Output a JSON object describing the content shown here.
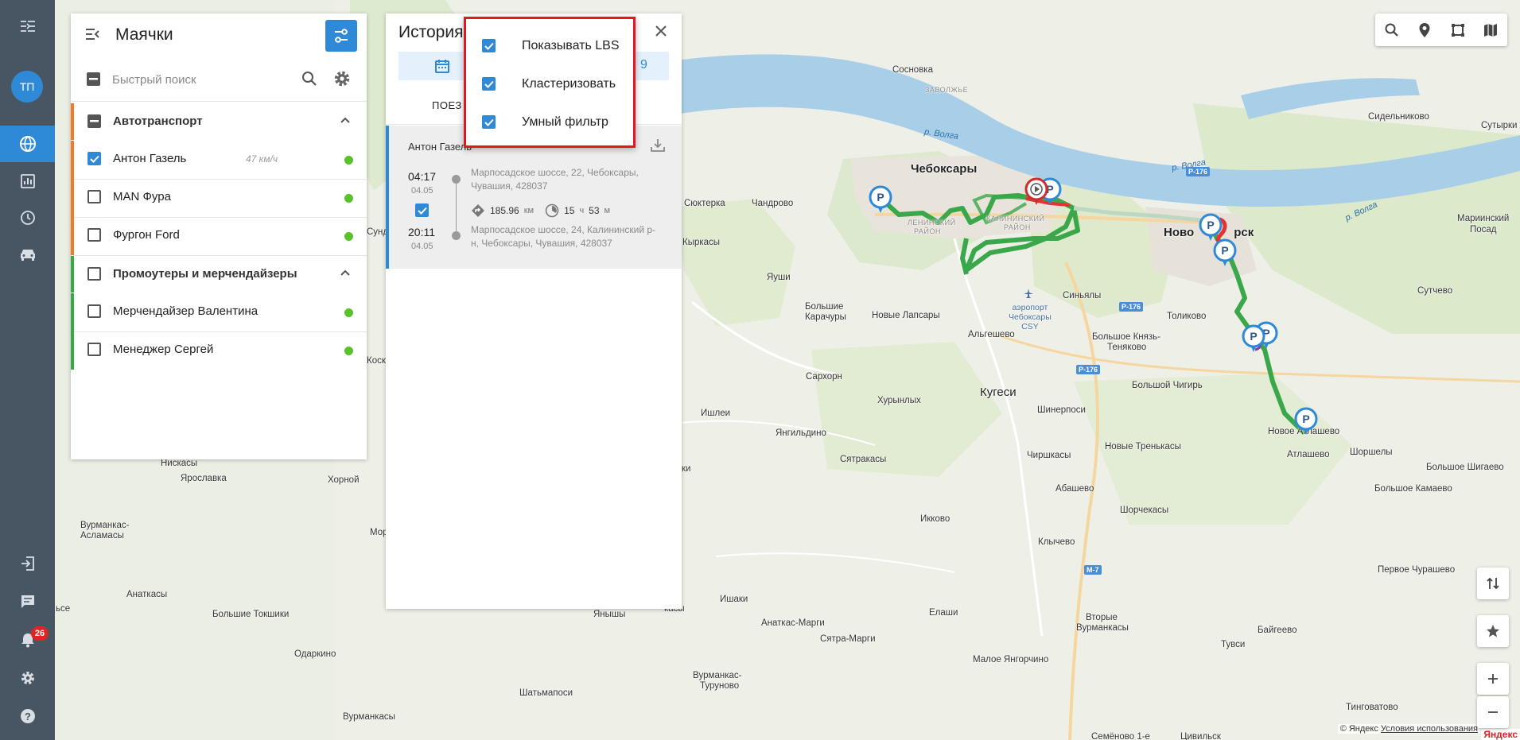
{
  "nav": {
    "avatar_initials": "ТП",
    "notifications_count": "26",
    "active_color": "#2e8ad6",
    "icons": [
      "menu-collapse-icon",
      "globe-icon",
      "chart-icon",
      "clock-icon",
      "car-icon",
      "logout-icon",
      "chat-icon",
      "bell-icon",
      "gear-icon",
      "help-icon"
    ]
  },
  "beacons": {
    "title": "Маячки",
    "search_placeholder": "Быстрый поиск",
    "groups": [
      {
        "name": "Автотранспорт",
        "color": "#f07a2a",
        "items": [
          {
            "name": "Антон Газель",
            "speed": "47 км/ч",
            "checked": true
          },
          {
            "name": "MAN Фура",
            "speed": "",
            "checked": false
          },
          {
            "name": "Фургон Ford",
            "speed": "",
            "checked": false
          }
        ]
      },
      {
        "name": "Промоутеры и мерчендайзеры",
        "color": "#3aa84a",
        "items": [
          {
            "name": "Мерчендайзер Валентина",
            "speed": "",
            "checked": false
          },
          {
            "name": "Менеджер Сергей",
            "speed": "",
            "checked": false
          }
        ]
      }
    ]
  },
  "history": {
    "title": "История",
    "date_end_fragment": "9",
    "tab_label": "ПОЕЗ",
    "trip": {
      "name": "Антон Газель",
      "start_time": "04:17",
      "start_date": "04.05",
      "end_time": "20:11",
      "end_date": "04.05",
      "start_address": "Марпосадское шоссе, 22, Чебоксары, Чувашия, 428037",
      "end_address": "Марпосадское шоссе, 24, Калининский р-н, Чебоксары, Чувашия, 428037",
      "distance": "185.96",
      "distance_unit": "км",
      "duration_h": "15",
      "duration_h_unit": "ч",
      "duration_m": "53",
      "duration_m_unit": "м"
    }
  },
  "popup": {
    "options": [
      {
        "label": "Показывать LBS",
        "checked": true
      },
      {
        "label": "Кластеризовать",
        "checked": true
      },
      {
        "label": "Умный фильтр",
        "checked": true
      }
    ]
  },
  "map": {
    "labels": {
      "cheboksary": "Чебоксары",
      "novocheboksarsk_a": "Ново",
      "novocheboksarsk_b": "рск",
      "kugesi": "Кугеси",
      "sosnovka": "Сосновка",
      "zavolzhe": "ЗАВОЛЖЬЕ",
      "volga1": "р. Волга",
      "volga2": "р. Волга",
      "volga3": "р. Волга",
      "sidelnikovo": "Сидельниково",
      "sutyrki": "Сутырки",
      "mariinsky1": "Мариинский",
      "mariinsky2": "Посад",
      "syuktyerka": "Сюктерка",
      "chandrovo": "Чандрово",
      "leninsky": "ЛЕНИНСКИЙ",
      "leninsky2": "РАЙОН",
      "kalininsky": "КАЛИНИНСКИЙ",
      "kalininsky2": "РАЙОН",
      "kyrkasy": "Кыркасы",
      "yaushi": "Яуши",
      "bolshie_karachury1": "Большие",
      "bolshie_karachury2": "Карачуры",
      "novye_lapsary": "Новые Лапсары",
      "airport1": "аэропорт",
      "airport2": "Чебоксары",
      "airport3": "CSY",
      "sinyaly": "Синьялы",
      "algeshevo": "Альгешево",
      "tolikovo": "Толиково",
      "sutchevo": "Сутчево",
      "bolshoe_knyaz1": "Большое Князь-",
      "bolshoe_knyaz2": "Теняково",
      "sarkhorn": "Сархорн",
      "khurynlykh": "Хурынлых",
      "bolshoy_chigir": "Большой Чигирь",
      "ishlei": "Ишлеи",
      "shinerposi": "Шинерпоси",
      "novoe_atlashevo": "Новое Атлашево",
      "atlashevo": "Атлашево",
      "shorshely": "Шоршелы",
      "yangildino": "Янгильдино",
      "syatrakasy": "Сятракасы",
      "novye_trenkasy": "Новые Тренькасы",
      "chirshkasy": "Чиршкасы",
      "bolshoe_shigaevo": "Большое Шигаево",
      "niskasy": "Нискасы",
      "yaroslavka": "Ярославка",
      "khorny": "Хорной",
      "abashevo": "Абашево",
      "bolshoe_kamaevo": "Большое Камаево",
      "shorchekasy": "Шорчекасы",
      "vurmankas_as1": "Вурманкас-",
      "vurmankas_as2": "Асламасы",
      "ikkovo": "Икково",
      "klychevo": "Клычево",
      "pervoe_churashevo": "Первое Чурашево",
      "anatkasy": "Анаткасы",
      "bolshie_tokshiki": "Большие Токшики",
      "ishaki": "Ишаки",
      "yanyshi": "Янышы",
      "elashi": "Елаши",
      "anatkas_margi": "Анаткас-Марги",
      "syatra_margi": "Сятра-Марги",
      "vtorye_vurmankasy1": "Вторые",
      "vtorye_vurmankasy2": "Вурманкасы",
      "baygeevo": "Байгеево",
      "tuvsi": "Тувси",
      "odarkino": "Одаркино",
      "maloe_yanogorchino": "Малое Янгорчино",
      "vurmankas_turunovo1": "Вурманкас-",
      "vurmankas_turunovo2": "Туруново",
      "shatmaposi": "Шатьмапоси",
      "vurmankasy": "Вурманкасы",
      "tingovatovo": "Тинговатово",
      "semenovo": "Семёново 1-е",
      "tsivilsk": "Цивильск",
      "sund": "Сунд",
      "koska": "Коска",
      "mor": "Мор",
      "kasy": "касы",
      "ki": "ки",
      "kasy2": "касы",
      "sye": "ьсе"
    },
    "roads": [
      "Р-176",
      "Р-176",
      "Р-176",
      "М-7"
    ],
    "copyright_prefix": "© Яндекс",
    "copyright_link": "Условия использования",
    "logo": "Яндекс",
    "track_color": "#3aa84a",
    "track_red_color": "#e63232",
    "water_color": "#a9cfe8"
  }
}
